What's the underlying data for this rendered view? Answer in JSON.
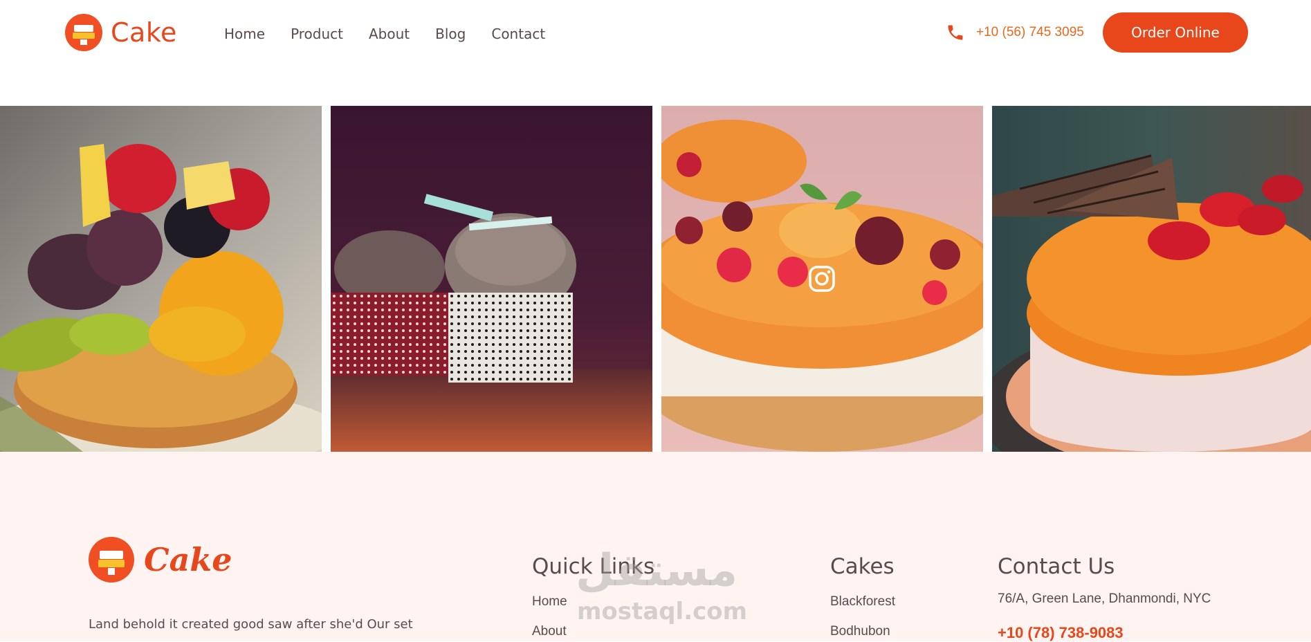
{
  "brand": {
    "name": "Cake",
    "footer_name": "Cake"
  },
  "nav": {
    "items": [
      {
        "label": "Home"
      },
      {
        "label": "Product"
      },
      {
        "label": "About"
      },
      {
        "label": "Blog"
      },
      {
        "label": "Contact"
      }
    ]
  },
  "header": {
    "phone": "+10 (56) 745 3095",
    "order_label": "Order Online"
  },
  "gallery": {
    "tiles": [
      {
        "subject": "fruit-tart"
      },
      {
        "subject": "cupcakes"
      },
      {
        "subject": "fruit-cheesecake",
        "overlay_icon": "instagram-icon"
      },
      {
        "subject": "orange-glazed-cake"
      }
    ]
  },
  "footer": {
    "description": "Land behold it created good saw after she'd Our set",
    "quick_links": {
      "title": "Quick Links",
      "items": [
        "Home",
        "About"
      ]
    },
    "cakes": {
      "title": "Cakes",
      "items": [
        "Blackforest",
        "Bodhubon"
      ]
    },
    "contact": {
      "title": "Contact Us",
      "address": "76/A, Green Lane, Dhanmondi, NYC",
      "phone": "+10 (78) 738-9083"
    }
  },
  "watermark": {
    "arabic": "مستقل",
    "latin": "mostaql.com"
  },
  "colors": {
    "accent": "#e8471b",
    "footer_bg": "#fff4f1",
    "text": "#5b4a4a"
  }
}
